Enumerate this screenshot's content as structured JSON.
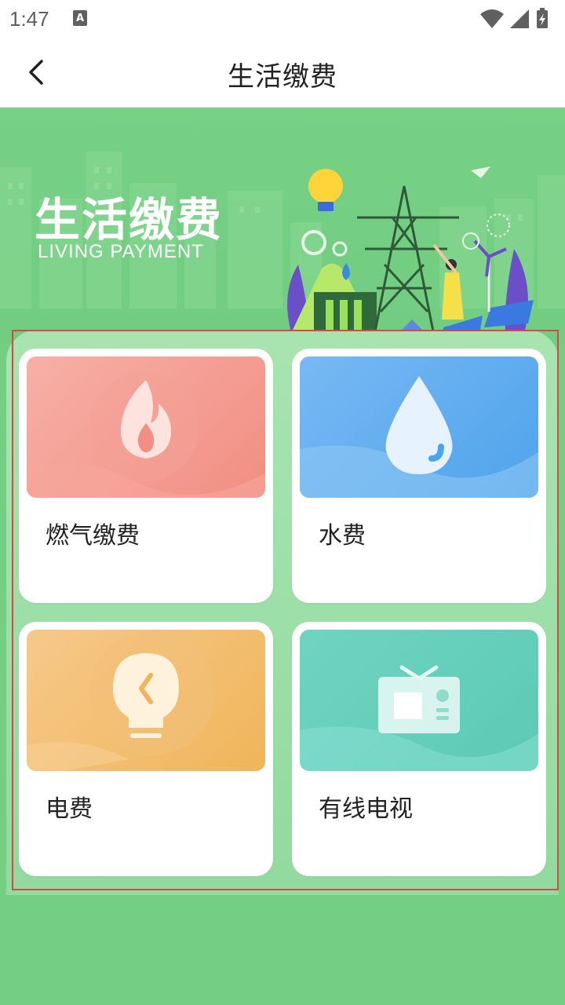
{
  "status_bar": {
    "time": "1:47",
    "icons": [
      "text-a-icon",
      "wifi-icon",
      "signal-icon",
      "battery-charging-icon"
    ]
  },
  "app_bar": {
    "title": "生活缴费",
    "back_icon": "chevron-left-icon"
  },
  "banner": {
    "title": "生活缴费",
    "subtitle": "LIVING PAYMENT"
  },
  "services": [
    {
      "label": "燃气缴费",
      "icon": "flame-icon",
      "color": "#f39a90"
    },
    {
      "label": "水费",
      "icon": "water-drop-icon",
      "color": "#5aacef"
    },
    {
      "label": "电费",
      "icon": "lightbulb-icon",
      "color": "#f2b95f"
    },
    {
      "label": "有线电视",
      "icon": "tv-icon",
      "color": "#62cdb9"
    }
  ],
  "colors": {
    "background": "#75cf82",
    "panel": "#a0e0a9",
    "highlight_border": "#d84848"
  }
}
